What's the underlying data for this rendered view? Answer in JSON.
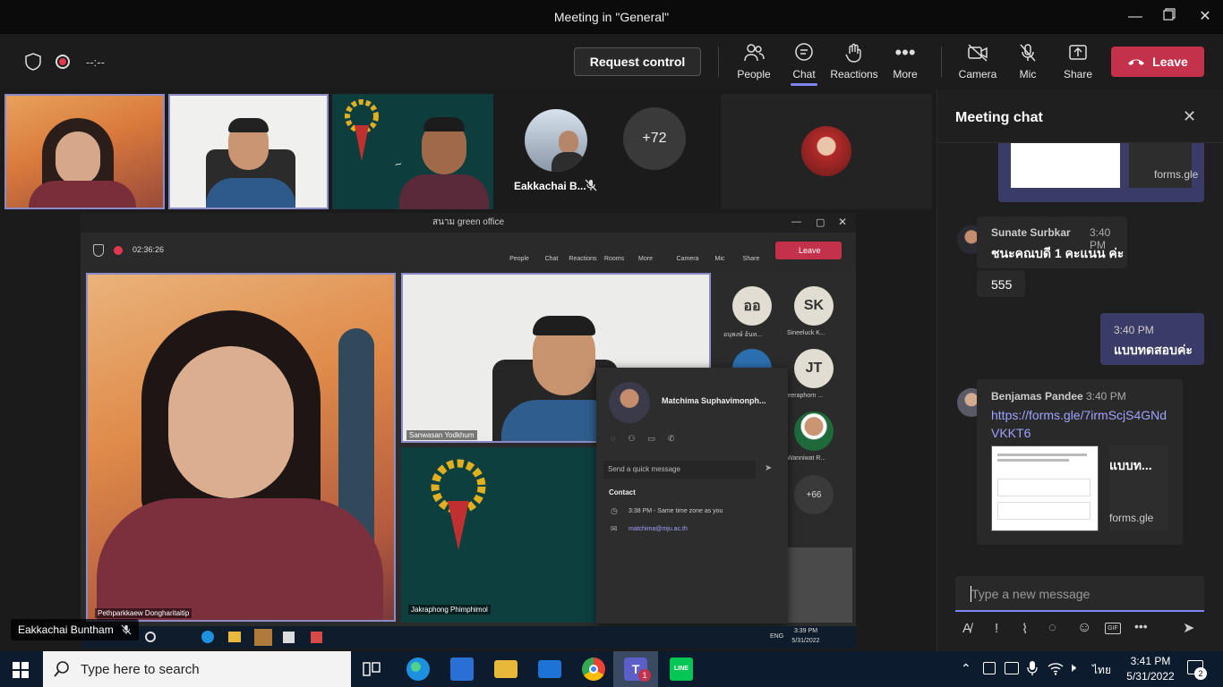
{
  "window": {
    "title": "Meeting in \"General\""
  },
  "toolbar": {
    "timer": "--:--",
    "request_control": "Request control",
    "people": "People",
    "chat": "Chat",
    "reactions": "Reactions",
    "more": "More",
    "camera": "Camera",
    "mic": "Mic",
    "share": "Share",
    "leave": "Leave"
  },
  "gallery": {
    "tile4_name": "Eakkachai B...",
    "overflow_count": "+72"
  },
  "speaker_label": "Eakkachai Buntham",
  "shared_screen": {
    "window_title": "สนาม green office",
    "timer": "02:36:26",
    "toolbar": [
      "People",
      "Chat",
      "Reactions",
      "Rooms",
      "More",
      "Camera",
      "Mic",
      "Share"
    ],
    "leave": "Leave",
    "tile1_name": "Pethparkkaew Dongharitaitip",
    "tile2_name": "Sanwasan Yodkhum",
    "tile3_name": "Jakraphong Phimphimol",
    "participants": [
      {
        "initials": "ออ",
        "name": "อนุพงษ์ อ้นท..."
      },
      {
        "initials": "SK",
        "name": "Sineeluck K..."
      },
      {
        "initials": "JT",
        "name": "Jeeraphorn ..."
      },
      {
        "initials": "",
        "name": "Wanniwat R..."
      }
    ],
    "more_count": "+66",
    "card": {
      "name": "Matchima Suphavimonph...",
      "quick_message": "Send a quick message",
      "contact_heading": "Contact",
      "local_time": "3:38 PM - Same time zone as you",
      "email": "matchima@mju.ac.th"
    },
    "taskbar_time": "3:39 PM",
    "taskbar_date": "5/31/2022",
    "taskbar_lang": "ENG"
  },
  "chat": {
    "title": "Meeting chat",
    "top_card_domain": "forms.gle",
    "messages": [
      {
        "author": "Sunate Surbkar",
        "time": "3:40 PM",
        "text": "ชนะคณบดี 1 คะแนน ค่ะ",
        "followup": "555"
      },
      {
        "time": "3:40 PM",
        "text": "แบบทดสอบค่ะ"
      },
      {
        "author": "Benjamas Pandee",
        "time": "3:40 PM",
        "link": "https://forms.gle/7irmScjS4GNdVKKT6",
        "card_title": "แบบท...",
        "card_domain": "forms.gle"
      }
    ],
    "input_placeholder": "Type a new message"
  },
  "taskbar": {
    "search_placeholder": "Type here to search",
    "time": "3:41 PM",
    "date": "5/31/2022",
    "lang": "ไทย",
    "notifications": "2"
  }
}
